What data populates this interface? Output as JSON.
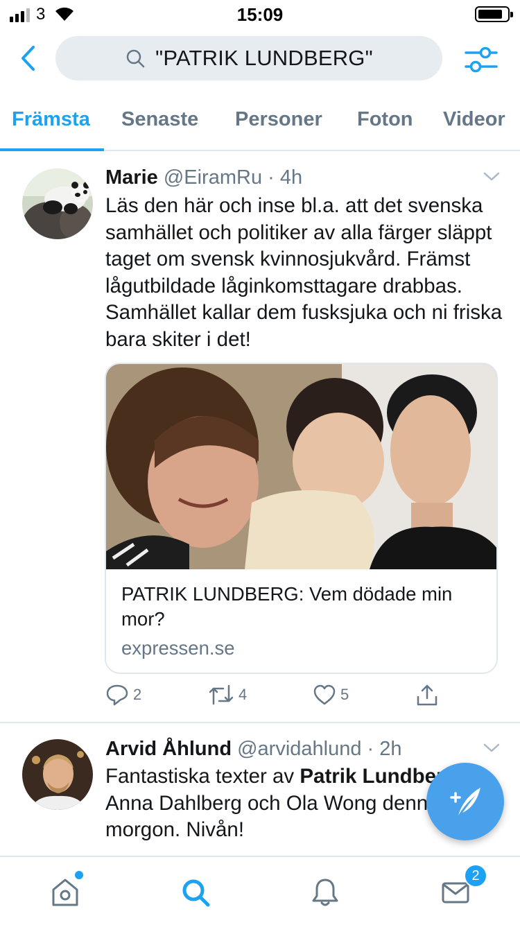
{
  "status_bar": {
    "carrier": "3",
    "time": "15:09"
  },
  "search": {
    "query": "\"PATRIK LUNDBERG\""
  },
  "tabs": [
    {
      "label": "Främsta",
      "active": true
    },
    {
      "label": "Senaste",
      "active": false
    },
    {
      "label": "Personer",
      "active": false
    },
    {
      "label": "Foton",
      "active": false
    },
    {
      "label": "Videor",
      "active": false
    }
  ],
  "tweets": [
    {
      "name": "Marie",
      "meta": "@EiramRu · 4h",
      "text": "Läs den här och inse bl.a. att det svenska samhället och politiker av alla färger släppt taget om svensk kvinnosjukvård. Främst lågutbildade låginkomsttagare drabbas. Samhället kallar dem fusksjuka och ni friska bara skiter i det!",
      "card": {
        "title": "PATRIK LUNDBERG: Vem dödade min mor?",
        "domain": "expressen.se"
      },
      "replies": "2",
      "retweets": "4",
      "likes": "5"
    },
    {
      "name": "Arvid Åhlund",
      "meta": "@arvidahlund · 2h",
      "text_before": "Fantastiska texter av ",
      "text_bold": "Patrik Lundberg,",
      "text_after": " Anna Dahlberg och Ola Wong denna morgon. Nivån!"
    }
  ],
  "bottom_nav": {
    "messages_badge": "2"
  },
  "colors": {
    "accent": "#1da1f2",
    "secondary_text": "#657786",
    "divider": "#e1e8ed",
    "search_bg": "#e6ecf0",
    "fab": "#4aa1eb"
  },
  "icons": [
    "back-icon",
    "search-icon",
    "filter-icon",
    "chevron-down-icon",
    "reply-icon",
    "retweet-icon",
    "like-icon",
    "share-icon",
    "compose-icon",
    "home-icon",
    "explore-icon",
    "notifications-icon",
    "messages-icon"
  ]
}
